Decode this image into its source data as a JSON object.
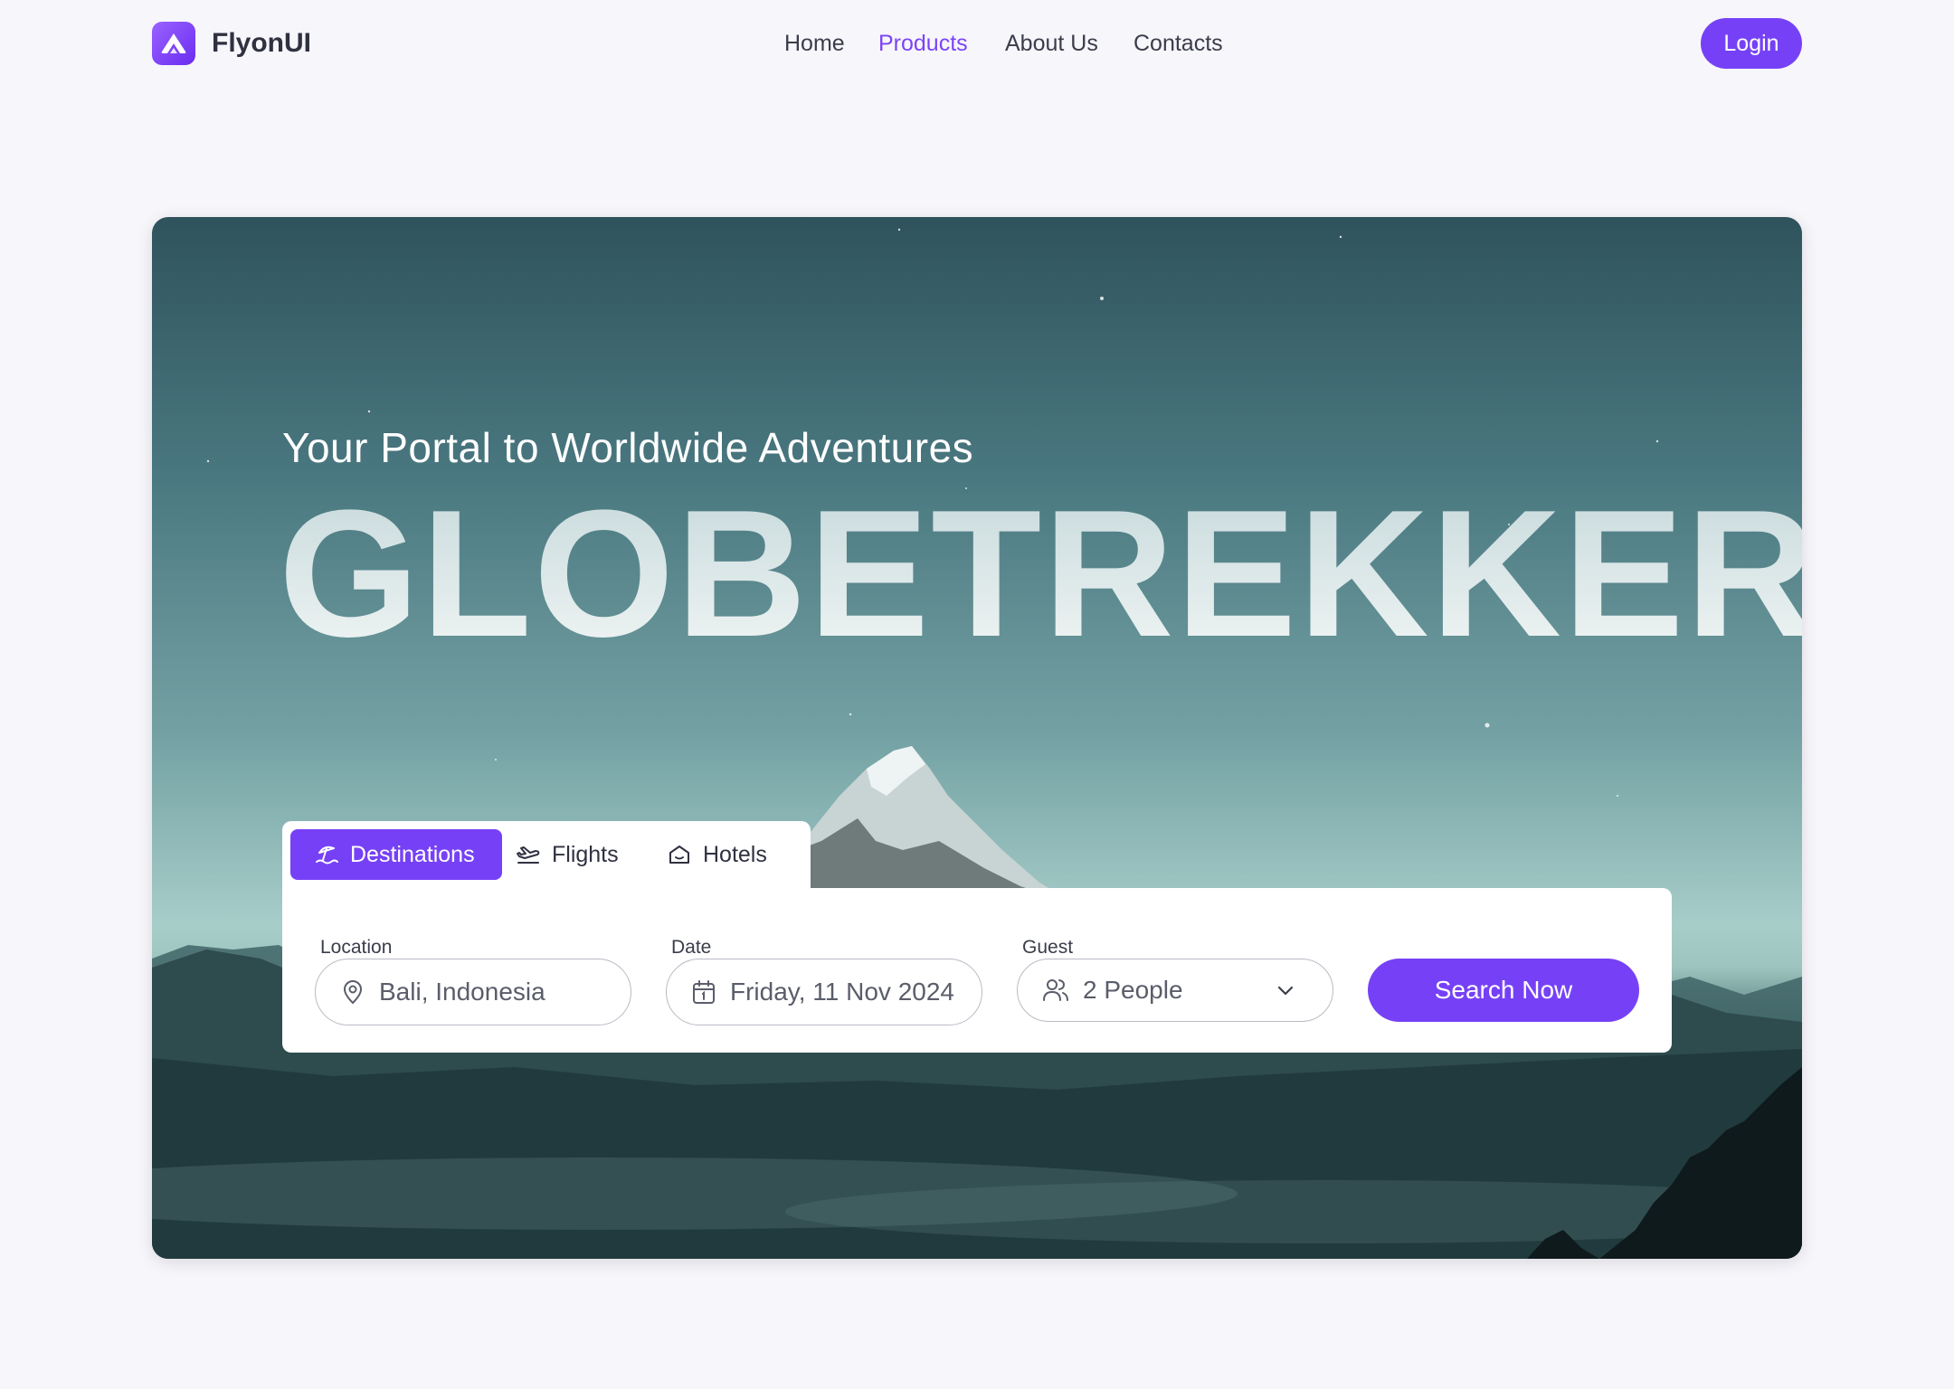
{
  "brand": {
    "name": "FlyonUI"
  },
  "nav": {
    "items": [
      {
        "label": "Home"
      },
      {
        "label": "Products"
      },
      {
        "label": "About Us"
      },
      {
        "label": "Contacts"
      }
    ],
    "active": "Products",
    "login_label": "Login"
  },
  "hero": {
    "subtitle": "Your Portal to Worldwide Adventures",
    "headline": "GLOBETREKKER"
  },
  "tabs": [
    {
      "label": "Destinations",
      "icon": "beach-umbrella-icon",
      "active": true
    },
    {
      "label": "Flights",
      "icon": "plane-icon",
      "active": false
    },
    {
      "label": "Hotels",
      "icon": "home-icon",
      "active": false
    }
  ],
  "search": {
    "location": {
      "label": "Location",
      "value": "Bali, Indonesia",
      "icon": "map-pin-icon"
    },
    "date": {
      "label": "Date",
      "value": "Friday, 11 Nov 2024",
      "icon": "calendar-icon"
    },
    "guest": {
      "label": "Guest",
      "value": "2 People",
      "icon": "users-icon"
    },
    "button_label": "Search Now"
  },
  "colors": {
    "accent": "#7641f6",
    "background": "#f7f6fb"
  }
}
